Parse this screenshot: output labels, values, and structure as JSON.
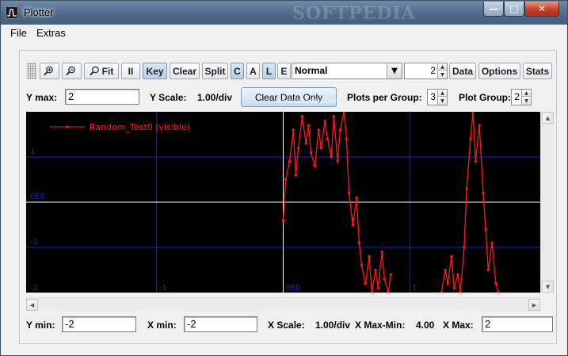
{
  "window": {
    "title": "Plotter",
    "watermark": "SOFTPEDIA"
  },
  "menu": {
    "file": "File",
    "extras": "Extras"
  },
  "toolbar": {
    "fit_label": "Fit",
    "pause_label": "II",
    "key_label": "Key",
    "clear_label": "Clear",
    "split_label": "Split",
    "c_label": "C",
    "a_label": "A",
    "l_label": "L",
    "e_label": "E",
    "mode_selected": "Normal",
    "spinner_value": "2",
    "data_label": "Data",
    "options_label": "Options",
    "stats_label": "Stats"
  },
  "controls": {
    "y_max_label": "Y max:",
    "y_max_value": "2",
    "y_scale_label": "Y Scale:",
    "y_scale_value": "1.00/div",
    "clear_data_label": "Clear Data Only",
    "plots_per_group_label": "Plots per Group:",
    "plots_per_group_value": "3",
    "plot_group_label": "Plot Group:",
    "plot_group_value": "2",
    "y_min_label": "Y min:",
    "y_min_value": "-2",
    "x_min_label": "X min:",
    "x_min_value": "-2",
    "x_scale_label": "X Scale:",
    "x_scale_value": "1.00/div",
    "x_max_min_label": "X Max-Min:",
    "x_max_min_value": "4.00",
    "x_max_label": "X Max:",
    "x_max_value": "2"
  },
  "plot": {
    "watermark": "www.softpedia.com",
    "legend": "Random_Test0 (visible)",
    "y_tick_labels": [
      "1",
      "0E0",
      "-1",
      "-2"
    ],
    "x_tick_labels": [
      "-1",
      "0E0",
      "1"
    ],
    "colors": {
      "background": "#000000",
      "grid": "#1f1fcc",
      "axes": "#ffffff",
      "series": "#ff1a1a"
    }
  },
  "chart_data": {
    "type": "line",
    "xlim": [
      -2,
      2
    ],
    "ylim": [
      -2,
      2
    ],
    "grid": true,
    "legend_position": "top-left",
    "series": [
      {
        "name": "Random_Test0 (visible)",
        "segments": [
          {
            "x": [
              0.0,
              0.02,
              0.05,
              0.08,
              0.1,
              0.12,
              0.15,
              0.18,
              0.2,
              0.22,
              0.25,
              0.28,
              0.3,
              0.33,
              0.35,
              0.38,
              0.4,
              0.43,
              0.45,
              0.48,
              0.5,
              0.52,
              0.55,
              0.58,
              0.6,
              0.62,
              0.65,
              0.68,
              0.7,
              0.73,
              0.75,
              0.78,
              0.8,
              0.83,
              0.85
            ],
            "y": [
              -0.4,
              0.5,
              0.9,
              1.6,
              0.6,
              1.2,
              1.9,
              1.3,
              1.7,
              1.1,
              0.8,
              1.6,
              1.2,
              1.8,
              1.4,
              1.0,
              1.9,
              0.9,
              1.6,
              2.0,
              1.4,
              0.2,
              -0.5,
              0.1,
              -0.9,
              -1.4,
              -1.8,
              -1.2,
              -2.0,
              -1.5,
              -1.9,
              -1.1,
              -1.7,
              -2.0,
              -1.6
            ]
          },
          {
            "x": [
              1.25,
              1.28,
              1.3,
              1.33,
              1.35,
              1.38,
              1.4,
              1.43,
              1.45,
              1.48,
              1.5,
              1.52,
              1.55,
              1.58,
              1.6,
              1.62,
              1.65,
              1.68,
              1.7
            ],
            "y": [
              -2.0,
              -1.5,
              -1.8,
              -1.2,
              -1.9,
              -1.6,
              -2.0,
              -1.0,
              0.3,
              1.4,
              2.0,
              0.9,
              1.7,
              0.2,
              -0.6,
              -1.5,
              -0.9,
              -1.8,
              -2.0
            ]
          }
        ]
      }
    ]
  }
}
